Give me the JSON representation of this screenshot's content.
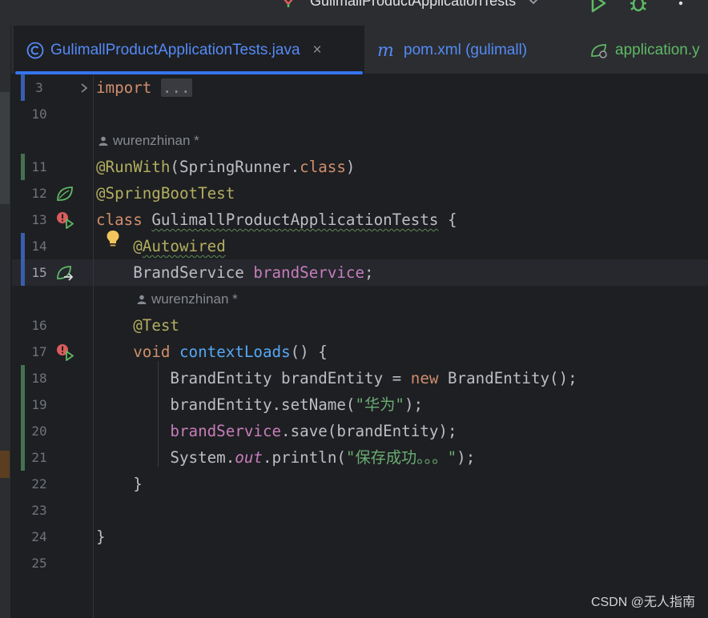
{
  "window": {
    "run_config_label": "GulimallProductApplicationTests",
    "buttons": [
      "run-icon",
      "debug-icon",
      "more-icon"
    ]
  },
  "tabs": [
    {
      "label": "GulimallProductApplicationTests.java",
      "icon": "java-class-icon",
      "active": true,
      "close": "×"
    },
    {
      "label": "pom.xml (gulimall)",
      "icon": "maven-icon",
      "active": false
    },
    {
      "label": "application.y",
      "icon": "spring-config-icon",
      "active": false
    }
  ],
  "editor": {
    "line_numbers": [
      "3",
      "10",
      "11",
      "12",
      "13",
      "14",
      "15",
      "16",
      "17",
      "18",
      "19",
      "20",
      "21",
      "22",
      "23",
      "24",
      "25"
    ],
    "inlay_author": "wurenzhinan *",
    "code": {
      "l3_import": "import",
      "l3_folded": "...",
      "l11_ann": "@RunWith",
      "l11_p1": "(SpringRunner.",
      "l11_kw": "class",
      "l11_p2": ")",
      "l12_ann": "@SpringBootTest",
      "l13_kw": "class",
      "l13_sp": " ",
      "l13_name": "GulimallProductApplicationTests",
      "l13_rest": " {",
      "l14_ann_at": "@",
      "l14_ann_name": "Autowired",
      "l15_type": "BrandService ",
      "l15_field": "brandService",
      "l15_end": ";",
      "l16_ann": "@Test",
      "l17_kw": "void",
      "l17_sp": " ",
      "l17_fn": "contextLoads",
      "l17_rest": "() {",
      "l18_a": "BrandEntity brandEntity = ",
      "l18_kw": "new",
      "l18_b": " BrandEntity();",
      "l19_a": "brandEntity.setName(",
      "l19_str": "\"华为\"",
      "l19_b": ");",
      "l20_field": "brandService",
      "l20_b": ".save(brandEntity);",
      "l21_a": "System.",
      "l21_static": "out",
      "l21_b": ".println(",
      "l21_str": "\"保存成功。。。\"",
      "l21_c": ");",
      "l22": "}",
      "l24": "}"
    }
  },
  "watermark": "CSDN @无人指南",
  "colors": {
    "background": "#1e1f22",
    "keyword": "#cf8e6d",
    "annotation": "#b3ae60",
    "field": "#c77dbb",
    "method": "#56a8f5",
    "string": "#6aab73",
    "accent": "#3574f0"
  }
}
